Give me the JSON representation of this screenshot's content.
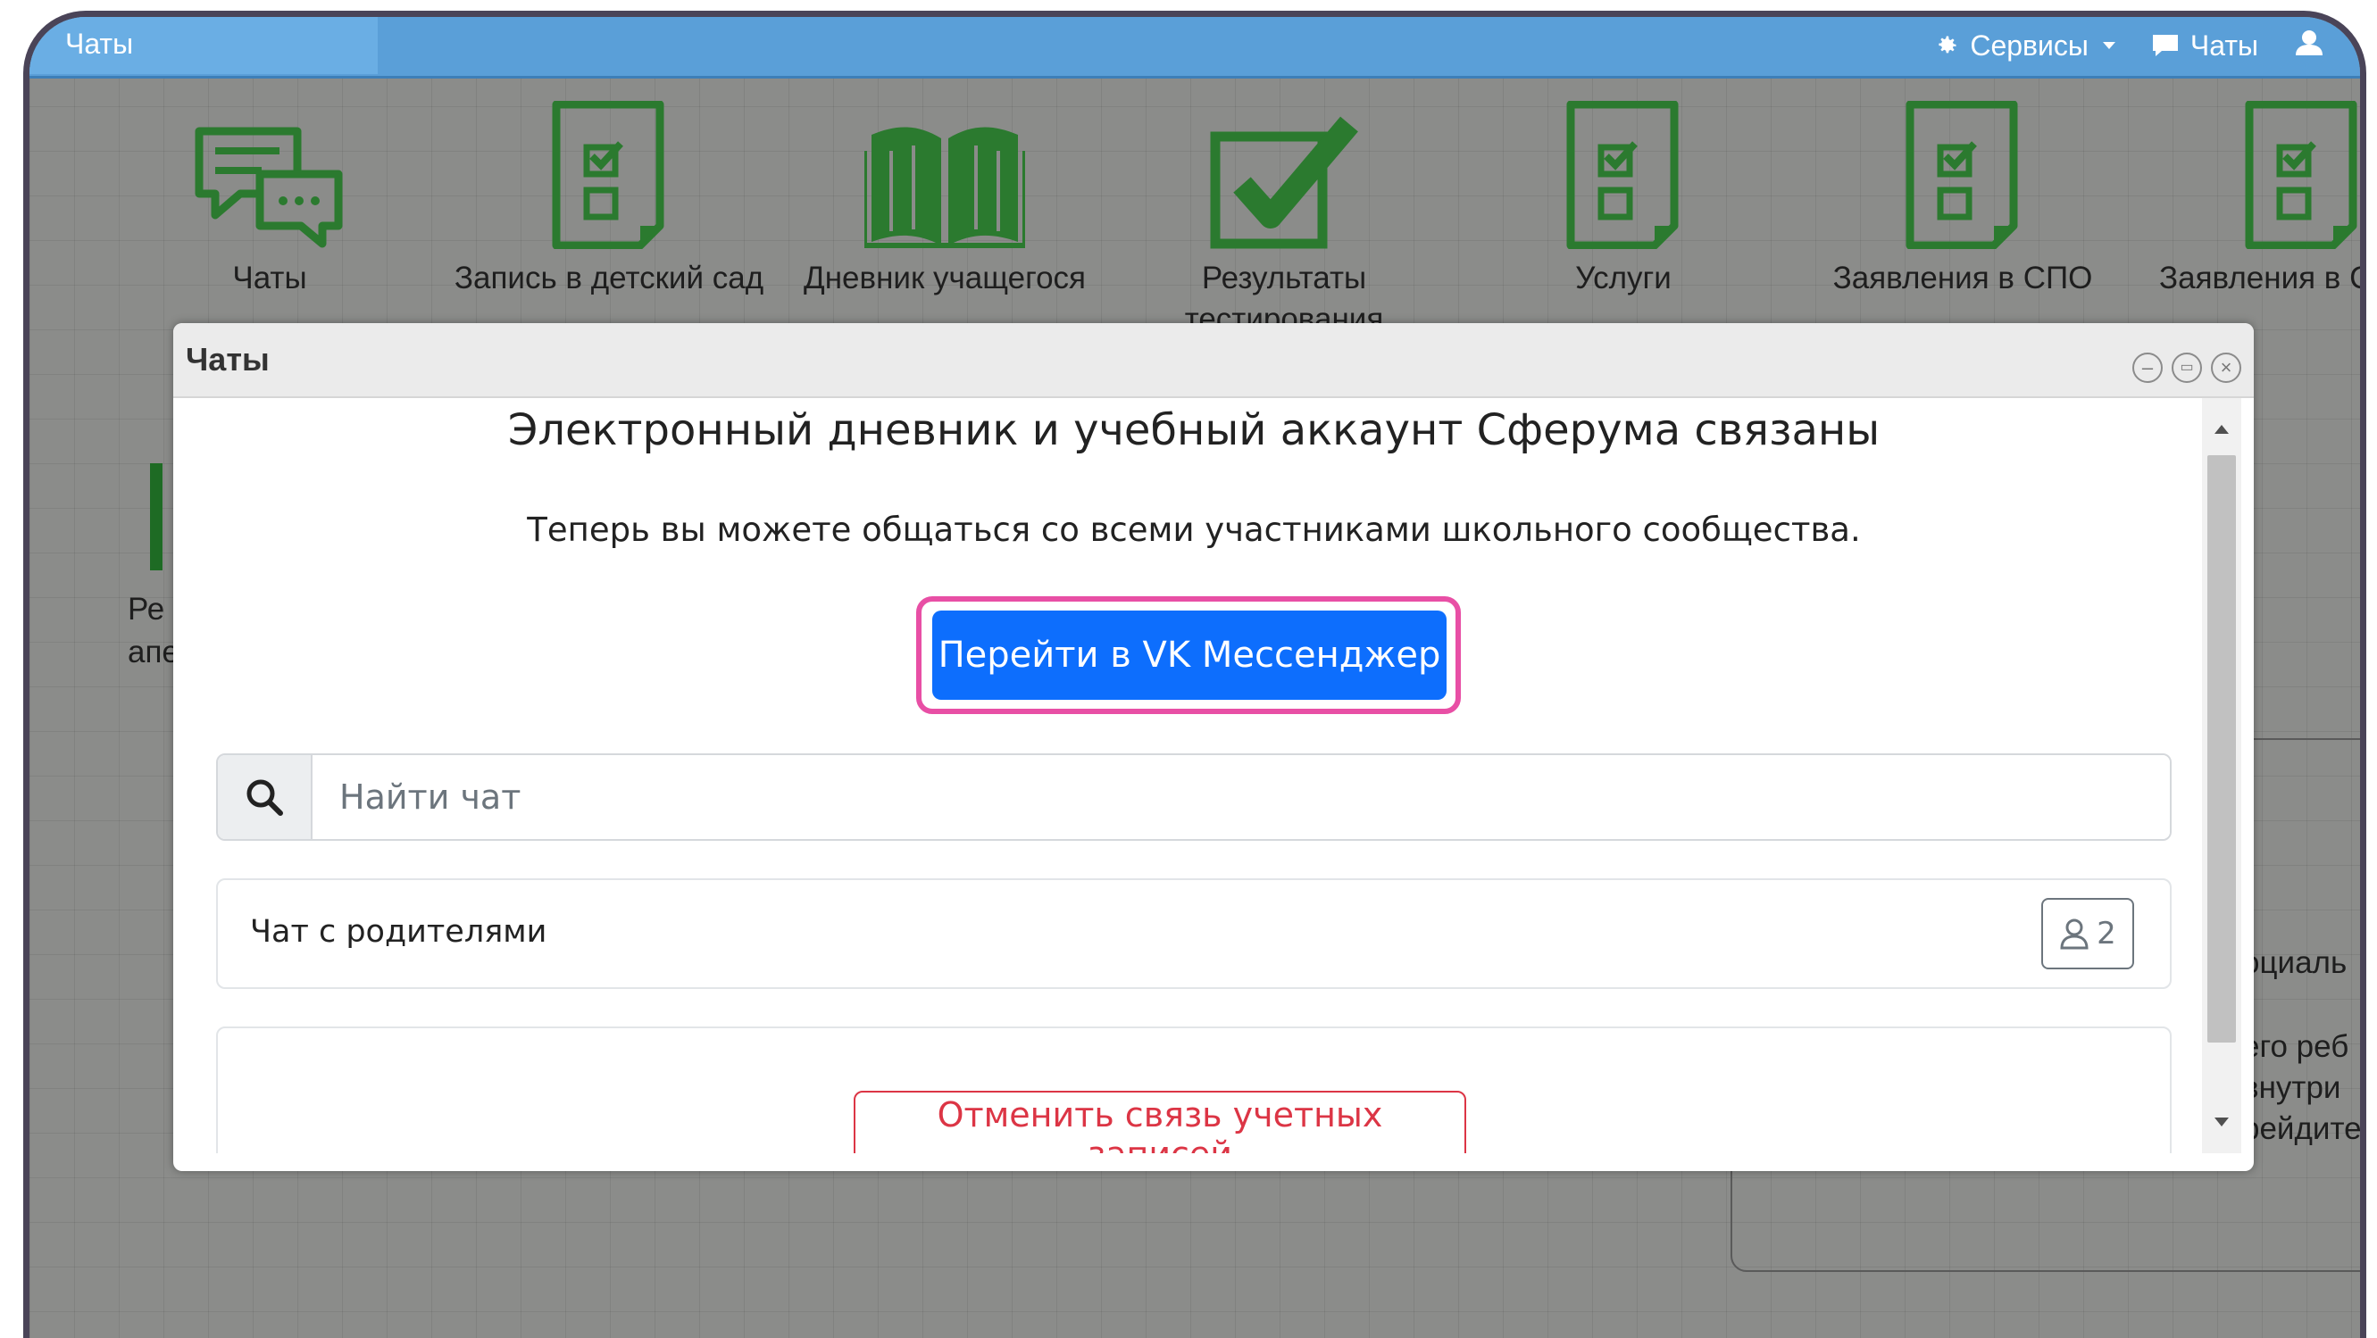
{
  "topbar": {
    "left_tab": "Чаты",
    "services_label": "Сервисы",
    "chats_label": "Чаты"
  },
  "tiles": [
    {
      "label": "Чаты",
      "icon": "chat-bubbles-icon"
    },
    {
      "label": "Запись в детский сад",
      "icon": "checklist-doc-icon"
    },
    {
      "label": "Дневник учащегося",
      "icon": "open-book-icon"
    },
    {
      "label": "Результаты тестирования",
      "icon": "checkbox-checked-icon"
    },
    {
      "label": "Услуги",
      "icon": "checklist-doc-icon"
    },
    {
      "label": "Заявления в СПО",
      "icon": "checklist-doc-icon"
    },
    {
      "label": "Заявления в С",
      "icon": "checklist-doc-icon"
    }
  ],
  "background": {
    "partial_tile_line1": "Ре",
    "partial_tile_line2": "апе",
    "right_text_1": "оциаль",
    "right_text_2": "его реб",
    "right_text_3": "внутри",
    "right_text_4": "рейдите"
  },
  "modal": {
    "title": "Чаты",
    "heading": "Электронный дневник и учебный аккаунт Сферума связаны",
    "subtext": "Теперь вы можете общаться со всеми участниками школьного сообщества.",
    "vk_button": "Перейти в VK Мессенджер",
    "search_placeholder": "Найти чат",
    "chats": [
      {
        "name": "Чат с родителями",
        "members": "2"
      }
    ],
    "unlink_button": "Отменить связь учетных записей"
  },
  "colors": {
    "tile_green": "#2b7a2f",
    "topbar_blue": "#5a9fd8",
    "primary_blue": "#0d6efd",
    "highlight_pink": "#e84fa5",
    "danger_red": "#dc3545"
  }
}
